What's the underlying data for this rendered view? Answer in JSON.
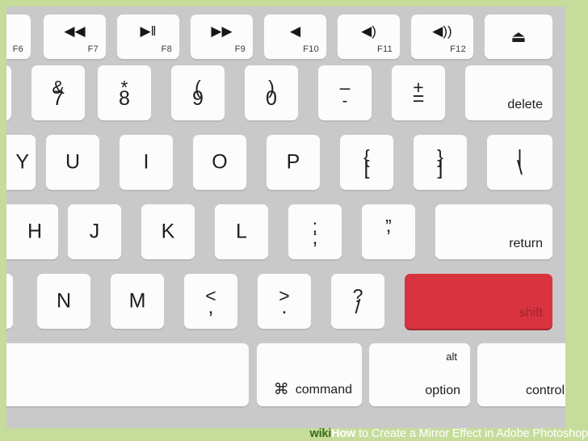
{
  "image": {
    "subject": "apple-keyboard-right-half",
    "mat_color": "#c5dc9b",
    "chassis_color": "#c9c9c9",
    "key_color": "#fcfcfc",
    "highlight_color": "#d93340",
    "highlight_label_color": "#a2232d"
  },
  "watermark": {
    "wiki": "wiki",
    "how": "How",
    "rest": "to Create a Mirror Effect in Adobe Photoshop"
  },
  "rows": {
    "function_row": [
      {
        "fn": "F6",
        "icon": ""
      },
      {
        "fn": "F7",
        "icon": "◀◀",
        "icon_name": "rewind-icon"
      },
      {
        "fn": "F8",
        "icon": "▶‖",
        "icon_name": "play-pause-icon"
      },
      {
        "fn": "F9",
        "icon": "▶▶",
        "icon_name": "fast-forward-icon"
      },
      {
        "fn": "F10",
        "icon": "◀",
        "icon_name": "mute-icon"
      },
      {
        "fn": "F11",
        "icon": "◀)",
        "icon_name": "volume-down-icon"
      },
      {
        "fn": "F12",
        "icon": "◀))",
        "icon_name": "volume-up-icon"
      },
      {
        "fn": "",
        "icon": "⏏",
        "icon_name": "eject-icon"
      }
    ],
    "number_row": [
      {
        "top": "&",
        "bottom": "7"
      },
      {
        "top": "*",
        "bottom": "8"
      },
      {
        "top": "(",
        "bottom": "9"
      },
      {
        "top": ")",
        "bottom": "0"
      },
      {
        "top": "–",
        "bottom": "-"
      },
      {
        "top": "+",
        "bottom": "="
      },
      {
        "label": "delete"
      }
    ],
    "qwerty_row": [
      {
        "label": "Y"
      },
      {
        "label": "U"
      },
      {
        "label": "I"
      },
      {
        "label": "O"
      },
      {
        "label": "P"
      },
      {
        "top": "{",
        "bottom": "["
      },
      {
        "top": "}",
        "bottom": "]"
      },
      {
        "top": "|",
        "bottom": "\\"
      }
    ],
    "home_row": [
      {
        "label": "H"
      },
      {
        "label": "J"
      },
      {
        "label": "K"
      },
      {
        "label": "L"
      },
      {
        "top": ":",
        "bottom": ";"
      },
      {
        "top": "”",
        "bottom": "’"
      },
      {
        "label": "return"
      }
    ],
    "bottom_letter_row": [
      {
        "label": ""
      },
      {
        "label": "N"
      },
      {
        "label": "M"
      },
      {
        "top": "<",
        "bottom": ","
      },
      {
        "top": ">",
        "bottom": "."
      },
      {
        "top": "?",
        "bottom": "/"
      },
      {
        "label": "shift",
        "highlighted": true
      }
    ],
    "modifier_row": [
      {
        "label": ""
      },
      {
        "glyph": "⌘",
        "label": "command"
      },
      {
        "top_label": "alt",
        "label": "option"
      },
      {
        "label": "control"
      }
    ]
  }
}
